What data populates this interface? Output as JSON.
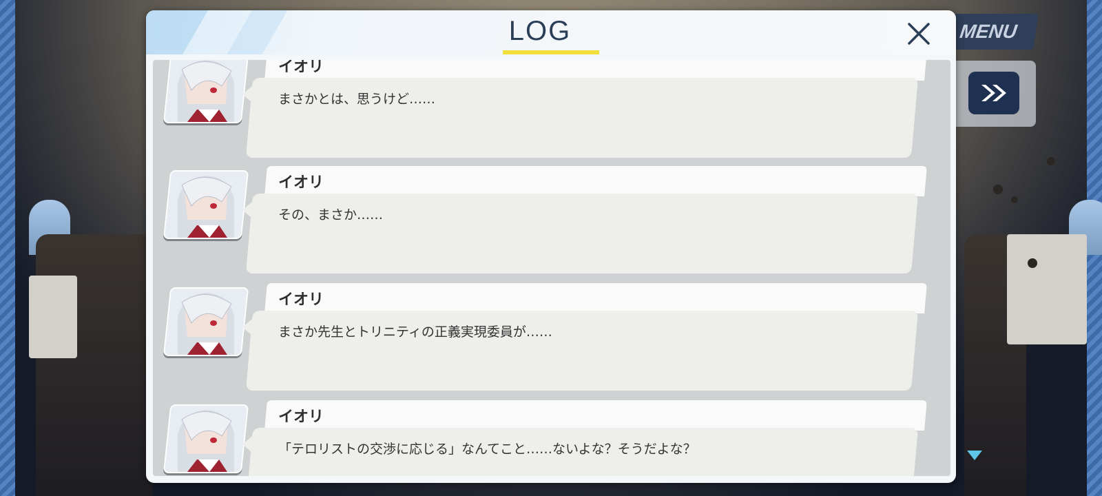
{
  "log_window": {
    "title": "LOG",
    "close_icon": "close-icon",
    "entries": [
      {
        "speaker": "イオリ",
        "text": "まさかとは、思うけど……"
      },
      {
        "speaker": "イオリ",
        "text": "その、まさか……"
      },
      {
        "speaker": "イオリ",
        "text": "まさか先生とトリニティの正義実現委員が……"
      },
      {
        "speaker": "イオリ",
        "text": "「テロリストの交渉に応じる」なんてこと……ないよな？そうだよな？"
      }
    ]
  },
  "hud": {
    "menu_label": "MENU",
    "fast_forward_icon": "fast-forward-icon",
    "scroll_indicator_icon": "triangle-down-icon"
  },
  "colors": {
    "title_text": "#2b3e58",
    "title_underline": "#f2e03a",
    "hud_button": "#1e3150",
    "bubble": "#eeeeeb"
  }
}
